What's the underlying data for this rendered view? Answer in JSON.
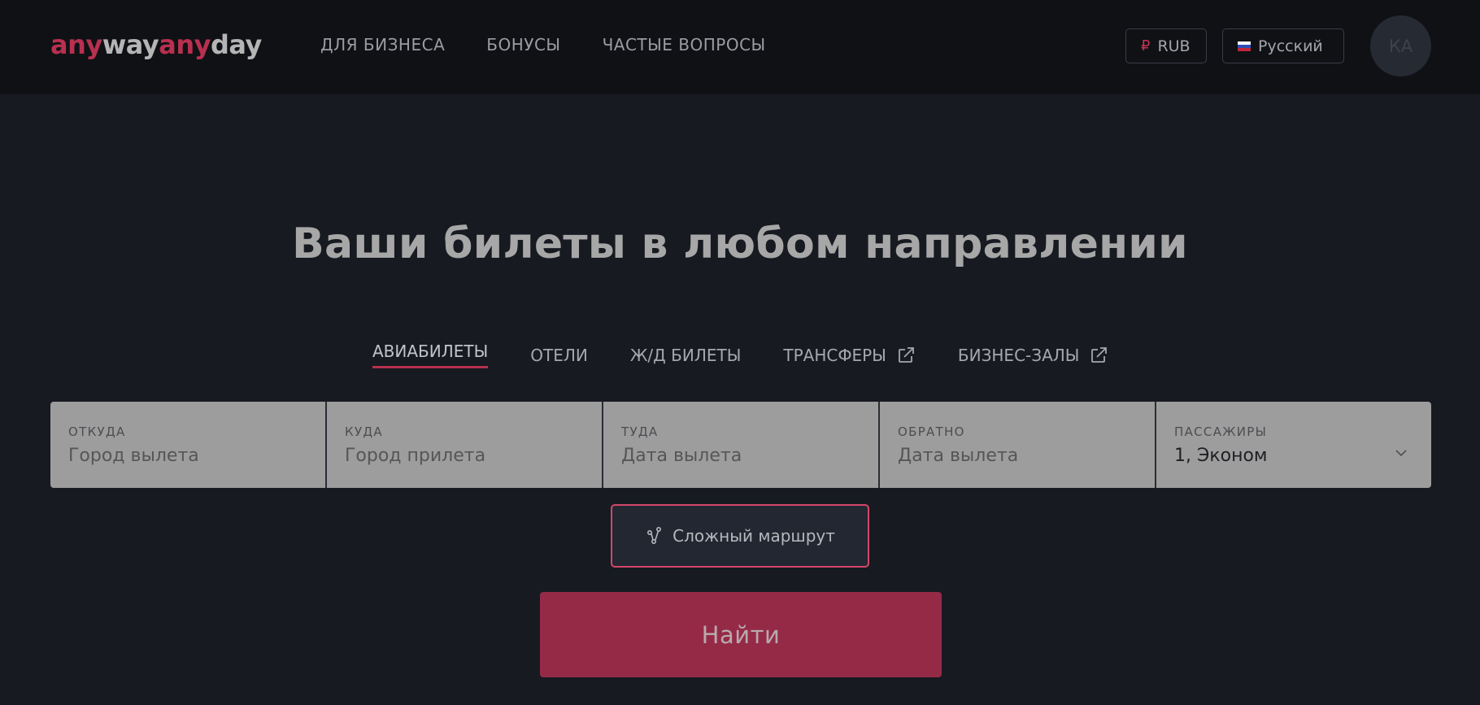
{
  "header": {
    "logo": {
      "part1": "any",
      "part2": "way",
      "part3": "any",
      "part4": "day"
    },
    "nav": [
      {
        "label": "ДЛЯ БИЗНЕСА"
      },
      {
        "label": "БОНУСЫ"
      },
      {
        "label": "ЧАСТЫЕ ВОПРОСЫ"
      }
    ],
    "currency": {
      "symbol": "₽",
      "label": "RUB"
    },
    "language": {
      "label": "Русский"
    },
    "avatar_initials": "КА"
  },
  "hero": {
    "title": "Ваши билеты в любом направлении"
  },
  "tabs": [
    {
      "label": "АВИАБИЛЕТЫ",
      "active": true,
      "external": false
    },
    {
      "label": "ОТЕЛИ",
      "active": false,
      "external": false
    },
    {
      "label": "Ж/Д БИЛЕТЫ",
      "active": false,
      "external": false
    },
    {
      "label": "ТРАНСФЕРЫ",
      "active": false,
      "external": true
    },
    {
      "label": "БИЗНЕС-ЗАЛЫ",
      "active": false,
      "external": true
    }
  ],
  "search": {
    "from": {
      "label": "ОТКУДА",
      "placeholder": "Город вылета"
    },
    "to": {
      "label": "КУДА",
      "placeholder": "Город прилета"
    },
    "depart": {
      "label": "ТУДА",
      "placeholder": "Дата вылета"
    },
    "return": {
      "label": "ОБРАТНО",
      "placeholder": "Дата вылета"
    },
    "passengers": {
      "label": "ПАССАЖИРЫ",
      "value": "1, Эконом"
    }
  },
  "complex_route": {
    "label": "Сложный маршрут"
  },
  "search_button": {
    "label": "Найти"
  },
  "colors": {
    "accent": "#b8304f",
    "button": "#952a47",
    "background": "#171a21",
    "header": "#0f1115"
  }
}
